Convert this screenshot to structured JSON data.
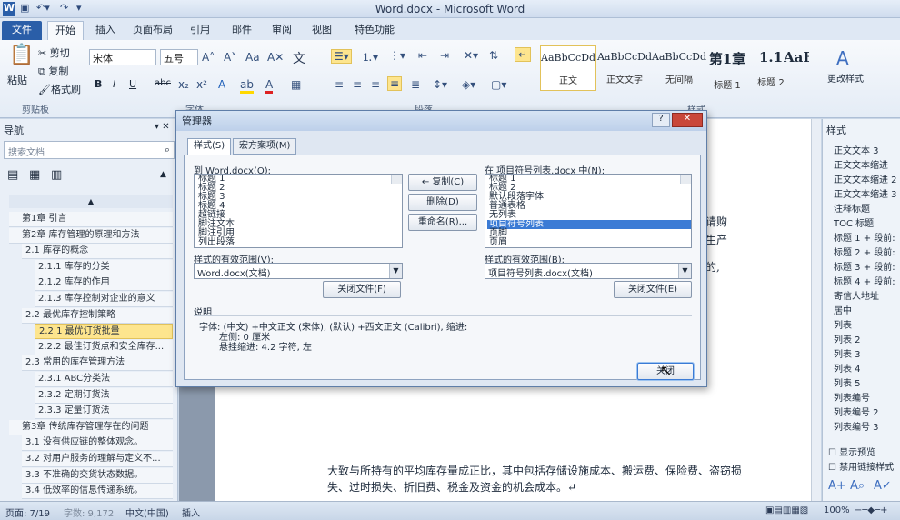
{
  "window": {
    "title": "Word.docx - Microsoft Word",
    "app_icon": "W"
  },
  "tabs": {
    "file": "文件",
    "items": [
      "开始",
      "插入",
      "页面布局",
      "引用",
      "邮件",
      "审阅",
      "视图",
      "特色功能"
    ]
  },
  "ribbon": {
    "paste": "粘贴",
    "cut": "剪切",
    "copy": "复制",
    "format_painter": "格式刷",
    "clipboard_group": "剪贴板",
    "font_name": "宋体",
    "font_size": "五号",
    "font_group": "字体",
    "text_effect": "文",
    "bold": "B",
    "italic": "I",
    "underline": "U",
    "strike": "abc",
    "paragraph_group": "段落",
    "styles_group": "样式",
    "change_styles": "更改样式",
    "style_items": [
      {
        "preview": "AaBbCcDd",
        "name": "正文"
      },
      {
        "preview": "AaBbCcDd",
        "name": "正文文字"
      },
      {
        "preview": "AaBbCcDd",
        "name": "无间隔"
      },
      {
        "preview": "第1章",
        "name": "标题 1"
      },
      {
        "preview": "1.1",
        "name": "标题 2"
      },
      {
        "preview": "AaB",
        "name": ""
      }
    ]
  },
  "nav": {
    "title": "导航",
    "search_placeholder": "搜索文档",
    "items": [
      {
        "text": "第1章 引言",
        "level": 0
      },
      {
        "text": "第2章 库存管理的原理和方法",
        "level": 0
      },
      {
        "text": "2.1 库存的概念",
        "level": 1
      },
      {
        "text": "2.1.1 库存的分类",
        "level": 2
      },
      {
        "text": "2.1.2 库存的作用",
        "level": 2
      },
      {
        "text": "2.1.3 库存控制对企业的意义",
        "level": 2
      },
      {
        "text": "2.2 最优库存控制策略",
        "level": 1
      },
      {
        "text": "2.2.1 最优订货批量",
        "level": 2,
        "selected": true
      },
      {
        "text": "2.2.2 最佳订货点和安全库存...",
        "level": 2
      },
      {
        "text": "2.3 常用的库存管理方法",
        "level": 1
      },
      {
        "text": "2.3.1 ABC分类法",
        "level": 2
      },
      {
        "text": "2.3.2 定期订货法",
        "level": 2
      },
      {
        "text": "2.3.3 定量订货法",
        "level": 2
      },
      {
        "text": "第3章 传统库存管理存在的问题",
        "level": 0
      },
      {
        "text": "3.1 没有供应链的整体观念。",
        "level": 1
      },
      {
        "text": "3.2 对用户服务的理解与定义不...",
        "level": 1
      },
      {
        "text": "3.3 不准确的交货状态数据。",
        "level": 1
      },
      {
        "text": "3.4 低效率的信息传递系统。",
        "level": 1
      }
    ]
  },
  "doc": {
    "line1": "大致与所持有的平均库存量成正比，其中包括存储设施成本、搬运费、保险费、盗窃损",
    "line2": "失、过时损失、折旧费、税金及资金的机会成本。↵",
    "frag1": "请购",
    "frag2": "生产",
    "frag3": "的,"
  },
  "styles_pane": {
    "title": "样式",
    "items": [
      "正文文本 3",
      "正文文本缩进",
      "正文文本缩进 2",
      "正文文本缩进 3",
      "注释标题",
      "TOC 标题",
      "标题 1 + 段前:",
      "标题 2 + 段前:",
      "标题 3 + 段前:",
      "标题 4 + 段前:",
      "寄信人地址",
      "居中",
      "列表",
      "列表 2",
      "列表 3",
      "列表 4",
      "列表 5",
      "列表编号",
      "列表编号 2",
      "列表编号 3"
    ],
    "show_preview": "显示预览",
    "disable_linked": "禁用链接样式"
  },
  "status": {
    "page": "页面: 7/19",
    "words": "字数: 9,172",
    "lang": "中文(中国)",
    "insert": "插入",
    "zoom": "100%"
  },
  "dialog": {
    "title": "管理器",
    "help": "?",
    "close": "✕",
    "tab_styles": "样式(S)",
    "tab_macros": "宏方案项(M)",
    "left_label": "到 Word.docx(O):",
    "left_items": [
      "标题 1",
      "标题 2",
      "标题 3",
      "标题 4",
      "超链接",
      "脚注文本",
      "脚注引用",
      "列出段落"
    ],
    "right_label": "在 项目符号列表.docx 中(N):",
    "right_items": [
      "标题 1",
      "标题 2",
      "默认段落字体",
      "普通表格",
      "无列表",
      "项目符号列表",
      "页脚",
      "页眉"
    ],
    "right_selected": 5,
    "copy": "← 复制(C)",
    "delete": "删除(D)",
    "rename": "重命名(R)...",
    "left_scope_label": "样式的有效范围(V):",
    "left_scope_value": "Word.docx(文档)",
    "right_scope_label": "样式的有效范围(B):",
    "right_scope_value": "项目符号列表.docx(文档)",
    "close_file": "关闭文件(F)",
    "close_file2": "关闭文件(E)",
    "desc_label": "说明",
    "desc1": "字体: (中文) +中文正文 (宋体), (默认) +西文正文 (Calibri), 缩进:",
    "desc2": "左侧: 0 厘米",
    "desc3": "悬挂缩进: 4.2 字符, 左",
    "close_btn": "关闭"
  }
}
